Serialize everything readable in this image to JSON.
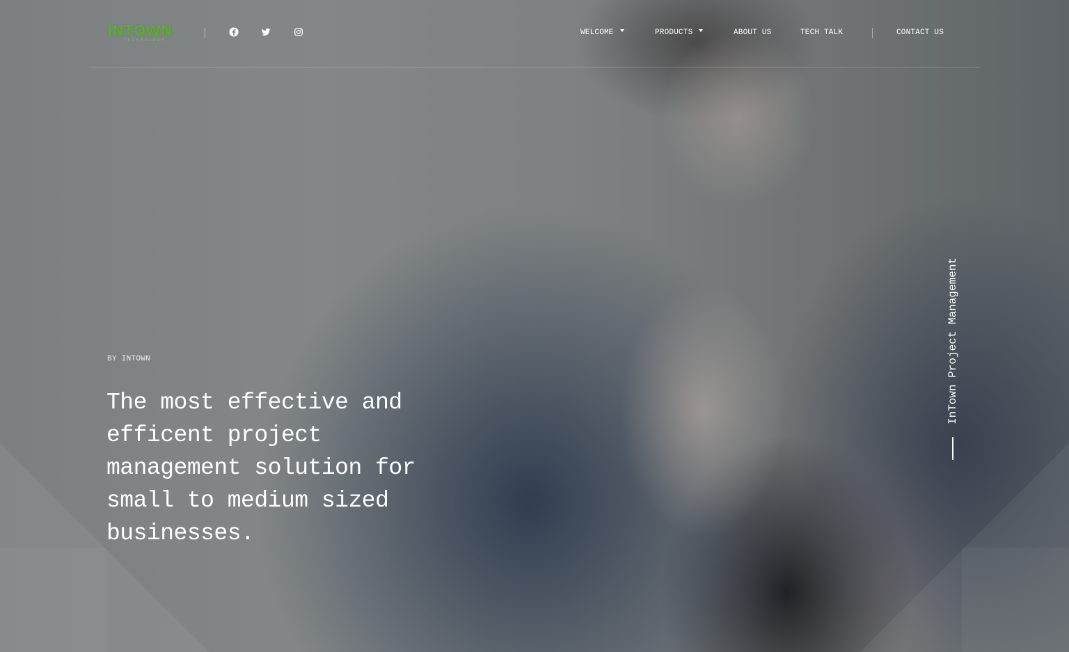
{
  "brand": {
    "logo_text": "INTOWN",
    "logo_subtext": "TECHNOLOGY",
    "accent_color": "#5fa83a"
  },
  "social": [
    {
      "name": "facebook",
      "icon": "facebook-icon"
    },
    {
      "name": "twitter",
      "icon": "twitter-icon"
    },
    {
      "name": "instagram",
      "icon": "instagram-icon"
    }
  ],
  "nav": {
    "welcome": "WELCOME",
    "products": "PRODUCTS",
    "about": "ABOUT US",
    "tech_talk": "TECH TALK",
    "contact": "CONTACT US"
  },
  "hero": {
    "eyebrow": "BY INTOWN",
    "headline": "The most effective and efficent project management solution for small to medium sized businesses.",
    "side_label": "InTown Project Management"
  }
}
